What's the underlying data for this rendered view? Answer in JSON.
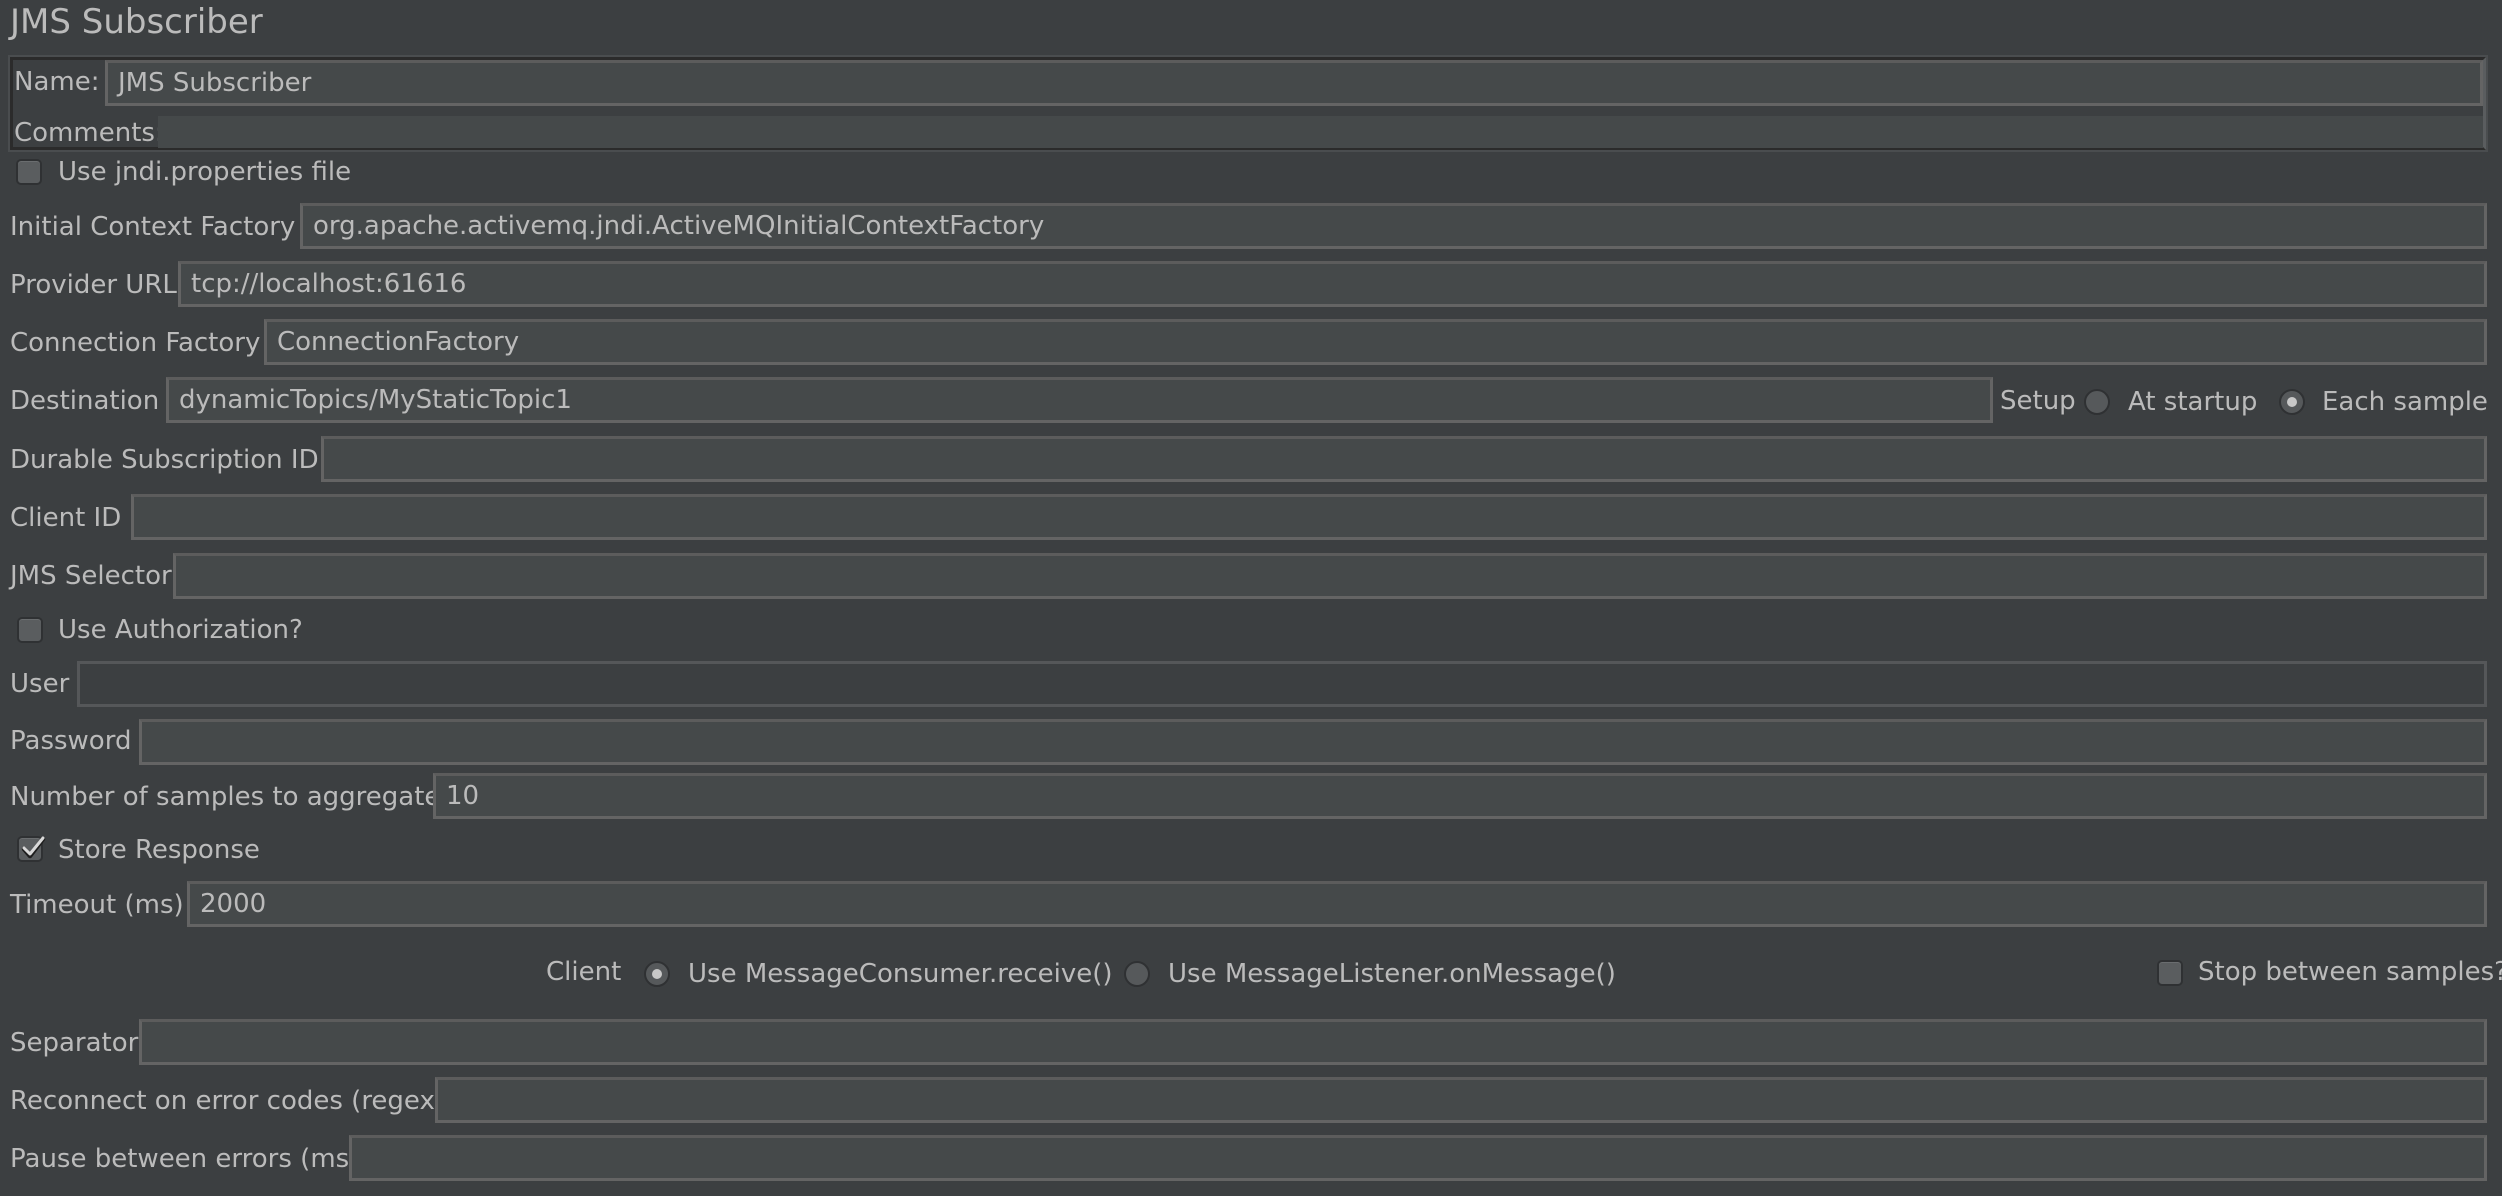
{
  "panel": {
    "title": "JMS Subscriber"
  },
  "name_field": {
    "label": "Name:",
    "value": "JMS Subscriber"
  },
  "comments_field": {
    "label": "Comments:",
    "value": ""
  },
  "use_jndi": {
    "label": "Use jndi.properties file",
    "checked": false
  },
  "initial_context_factory": {
    "label": "Initial Context Factory",
    "value": "org.apache.activemq.jndi.ActiveMQInitialContextFactory"
  },
  "provider_url": {
    "label": "Provider URL",
    "value": "tcp://localhost:61616"
  },
  "connection_factory": {
    "label": "Connection Factory",
    "value": "ConnectionFactory"
  },
  "destination": {
    "label": "Destination",
    "value": "dynamicTopics/MyStaticTopic1"
  },
  "setup": {
    "label": "Setup",
    "options": [
      {
        "label": "At startup",
        "selected": false
      },
      {
        "label": "Each sample",
        "selected": true
      }
    ]
  },
  "durable_subscription_id": {
    "label": "Durable Subscription ID",
    "value": ""
  },
  "client_id": {
    "label": "Client ID",
    "value": ""
  },
  "jms_selector": {
    "label": "JMS Selector",
    "value": ""
  },
  "use_authorization": {
    "label": "Use Authorization?",
    "checked": false
  },
  "user": {
    "label": "User",
    "value": ""
  },
  "password": {
    "label": "Password",
    "value": ""
  },
  "number_of_samples": {
    "label": "Number of samples to aggregate",
    "value": "10"
  },
  "store_response": {
    "label": "Store Response",
    "checked": true
  },
  "timeout": {
    "label": "Timeout (ms)",
    "value": "2000"
  },
  "client": {
    "label": "Client",
    "options": [
      {
        "label": "Use MessageConsumer.receive()",
        "selected": true
      },
      {
        "label": "Use MessageListener.onMessage()",
        "selected": false
      }
    ]
  },
  "stop_between_samples": {
    "label": "Stop between samples?",
    "checked": false
  },
  "separator": {
    "label": "Separator",
    "value": ""
  },
  "reconnect_on_error_codes": {
    "label": "Reconnect on error codes (regex)",
    "value": ""
  },
  "pause_between_errors": {
    "label": "Pause between errors (ms)",
    "value": ""
  }
}
